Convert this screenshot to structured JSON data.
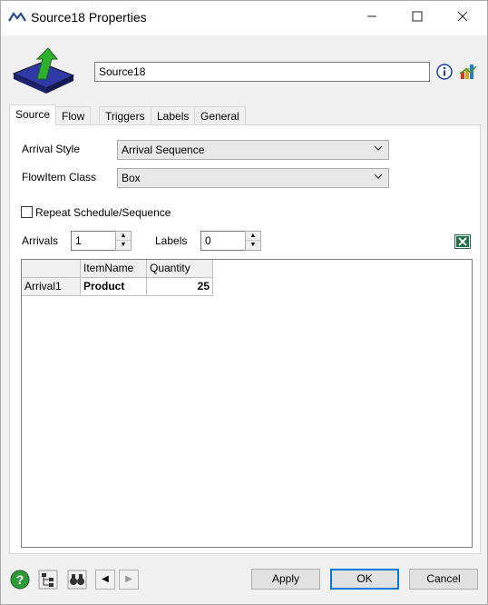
{
  "window": {
    "title": "Source18  Properties",
    "minimize": "—",
    "maximize": "☐",
    "close": "✕"
  },
  "header": {
    "object_name": "Source18"
  },
  "tabs": [
    {
      "label": "Source",
      "active": true
    },
    {
      "label": "Flow",
      "active": false
    },
    {
      "label": "Triggers",
      "active": false
    },
    {
      "label": "Labels",
      "active": false
    },
    {
      "label": "General",
      "active": false
    }
  ],
  "source_tab": {
    "arrival_style_label": "Arrival Style",
    "arrival_style_value": "Arrival Sequence",
    "flowitem_class_label": "FlowItem Class",
    "flowitem_class_value": "Box",
    "repeat_label": "Repeat Schedule/Sequence",
    "repeat_checked": false,
    "arrivals_label": "Arrivals",
    "arrivals_value": "1",
    "labels_label": "Labels",
    "labels_value": "0"
  },
  "table": {
    "columns": [
      "ItemName",
      "Quantity"
    ],
    "rows": [
      {
        "header": "Arrival1",
        "cells": [
          "Product",
          "25"
        ]
      }
    ]
  },
  "footer": {
    "apply": "Apply",
    "ok": "OK",
    "cancel": "Cancel"
  },
  "icons": {
    "help": "help-icon",
    "tree": "tree-icon",
    "find": "binoculars-icon",
    "prev": "arrow-left-icon",
    "next": "arrow-right-icon",
    "info": "info-icon",
    "stats": "chart-icon",
    "excel": "excel-icon"
  },
  "colors": {
    "accent": "#0078d7",
    "info_blue": "#1a3ea8",
    "excel_green": "#1e7145",
    "help_green": "#2e9b38"
  }
}
